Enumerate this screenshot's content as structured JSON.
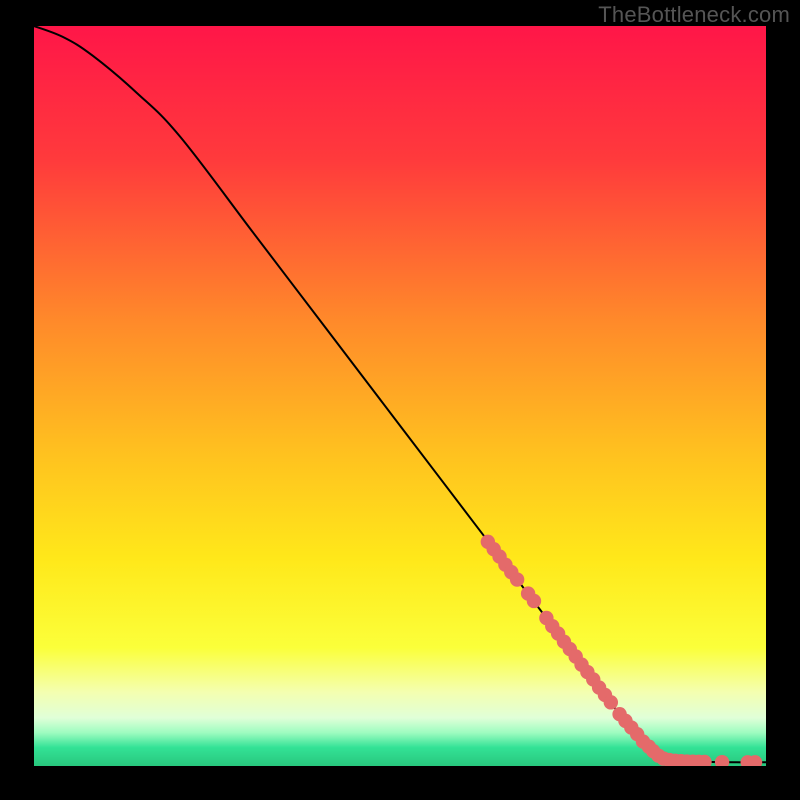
{
  "watermark": "TheBottleneck.com",
  "colors": {
    "curve": "#000000",
    "marker_fill": "#e46a6a",
    "marker_stroke": "#c94f4f",
    "gradient_stops": [
      {
        "offset": "0%",
        "color": "#ff1648"
      },
      {
        "offset": "18%",
        "color": "#ff3a3c"
      },
      {
        "offset": "40%",
        "color": "#ff8a2a"
      },
      {
        "offset": "58%",
        "color": "#ffc21f"
      },
      {
        "offset": "72%",
        "color": "#ffe81a"
      },
      {
        "offset": "84%",
        "color": "#fbff3a"
      },
      {
        "offset": "90%",
        "color": "#f4ffb0"
      },
      {
        "offset": "93.5%",
        "color": "#e0ffd8"
      },
      {
        "offset": "95.5%",
        "color": "#9efcc0"
      },
      {
        "offset": "97.5%",
        "color": "#33e296"
      },
      {
        "offset": "100%",
        "color": "#28c77d"
      }
    ]
  },
  "chart_data": {
    "type": "line",
    "title": "",
    "xlabel": "",
    "ylabel": "",
    "xlim": [
      0,
      100
    ],
    "ylim": [
      0,
      100
    ],
    "series": [
      {
        "name": "curve",
        "x": [
          0,
          4,
          8,
          14,
          20,
          30,
          40,
          50,
          60,
          70,
          75,
          80,
          83,
          85,
          88,
          92,
          96,
          100
        ],
        "y": [
          100,
          98.5,
          96,
          91,
          85,
          72,
          59,
          46,
          33,
          20,
          13.5,
          7,
          3.5,
          1.6,
          0.7,
          0.55,
          0.5,
          0.5
        ]
      }
    ],
    "scatter_overlay": {
      "name": "dense-tail-markers",
      "points": [
        {
          "x": 62.0,
          "y": 30.3
        },
        {
          "x": 62.8,
          "y": 29.3
        },
        {
          "x": 63.6,
          "y": 28.3
        },
        {
          "x": 64.4,
          "y": 27.2
        },
        {
          "x": 65.2,
          "y": 26.2
        },
        {
          "x": 66.0,
          "y": 25.2
        },
        {
          "x": 67.5,
          "y": 23.3
        },
        {
          "x": 68.3,
          "y": 22.3
        },
        {
          "x": 70.0,
          "y": 20.0
        },
        {
          "x": 70.8,
          "y": 18.9
        },
        {
          "x": 71.6,
          "y": 17.9
        },
        {
          "x": 72.4,
          "y": 16.8
        },
        {
          "x": 73.2,
          "y": 15.8
        },
        {
          "x": 74.0,
          "y": 14.8
        },
        {
          "x": 74.8,
          "y": 13.7
        },
        {
          "x": 75.6,
          "y": 12.7
        },
        {
          "x": 76.4,
          "y": 11.7
        },
        {
          "x": 77.2,
          "y": 10.6
        },
        {
          "x": 78.0,
          "y": 9.6
        },
        {
          "x": 78.8,
          "y": 8.6
        },
        {
          "x": 80.0,
          "y": 7.0
        },
        {
          "x": 80.8,
          "y": 6.1
        },
        {
          "x": 81.6,
          "y": 5.2
        },
        {
          "x": 82.4,
          "y": 4.3
        },
        {
          "x": 83.2,
          "y": 3.3
        },
        {
          "x": 84.0,
          "y": 2.6
        },
        {
          "x": 84.6,
          "y": 2.0
        },
        {
          "x": 85.3,
          "y": 1.4
        },
        {
          "x": 86.0,
          "y": 1.0
        },
        {
          "x": 86.8,
          "y": 0.8
        },
        {
          "x": 87.6,
          "y": 0.7
        },
        {
          "x": 88.4,
          "y": 0.65
        },
        {
          "x": 89.2,
          "y": 0.6
        },
        {
          "x": 90.0,
          "y": 0.58
        },
        {
          "x": 90.8,
          "y": 0.56
        },
        {
          "x": 91.6,
          "y": 0.55
        },
        {
          "x": 94.0,
          "y": 0.52
        },
        {
          "x": 97.5,
          "y": 0.5
        },
        {
          "x": 98.5,
          "y": 0.5
        }
      ]
    }
  }
}
